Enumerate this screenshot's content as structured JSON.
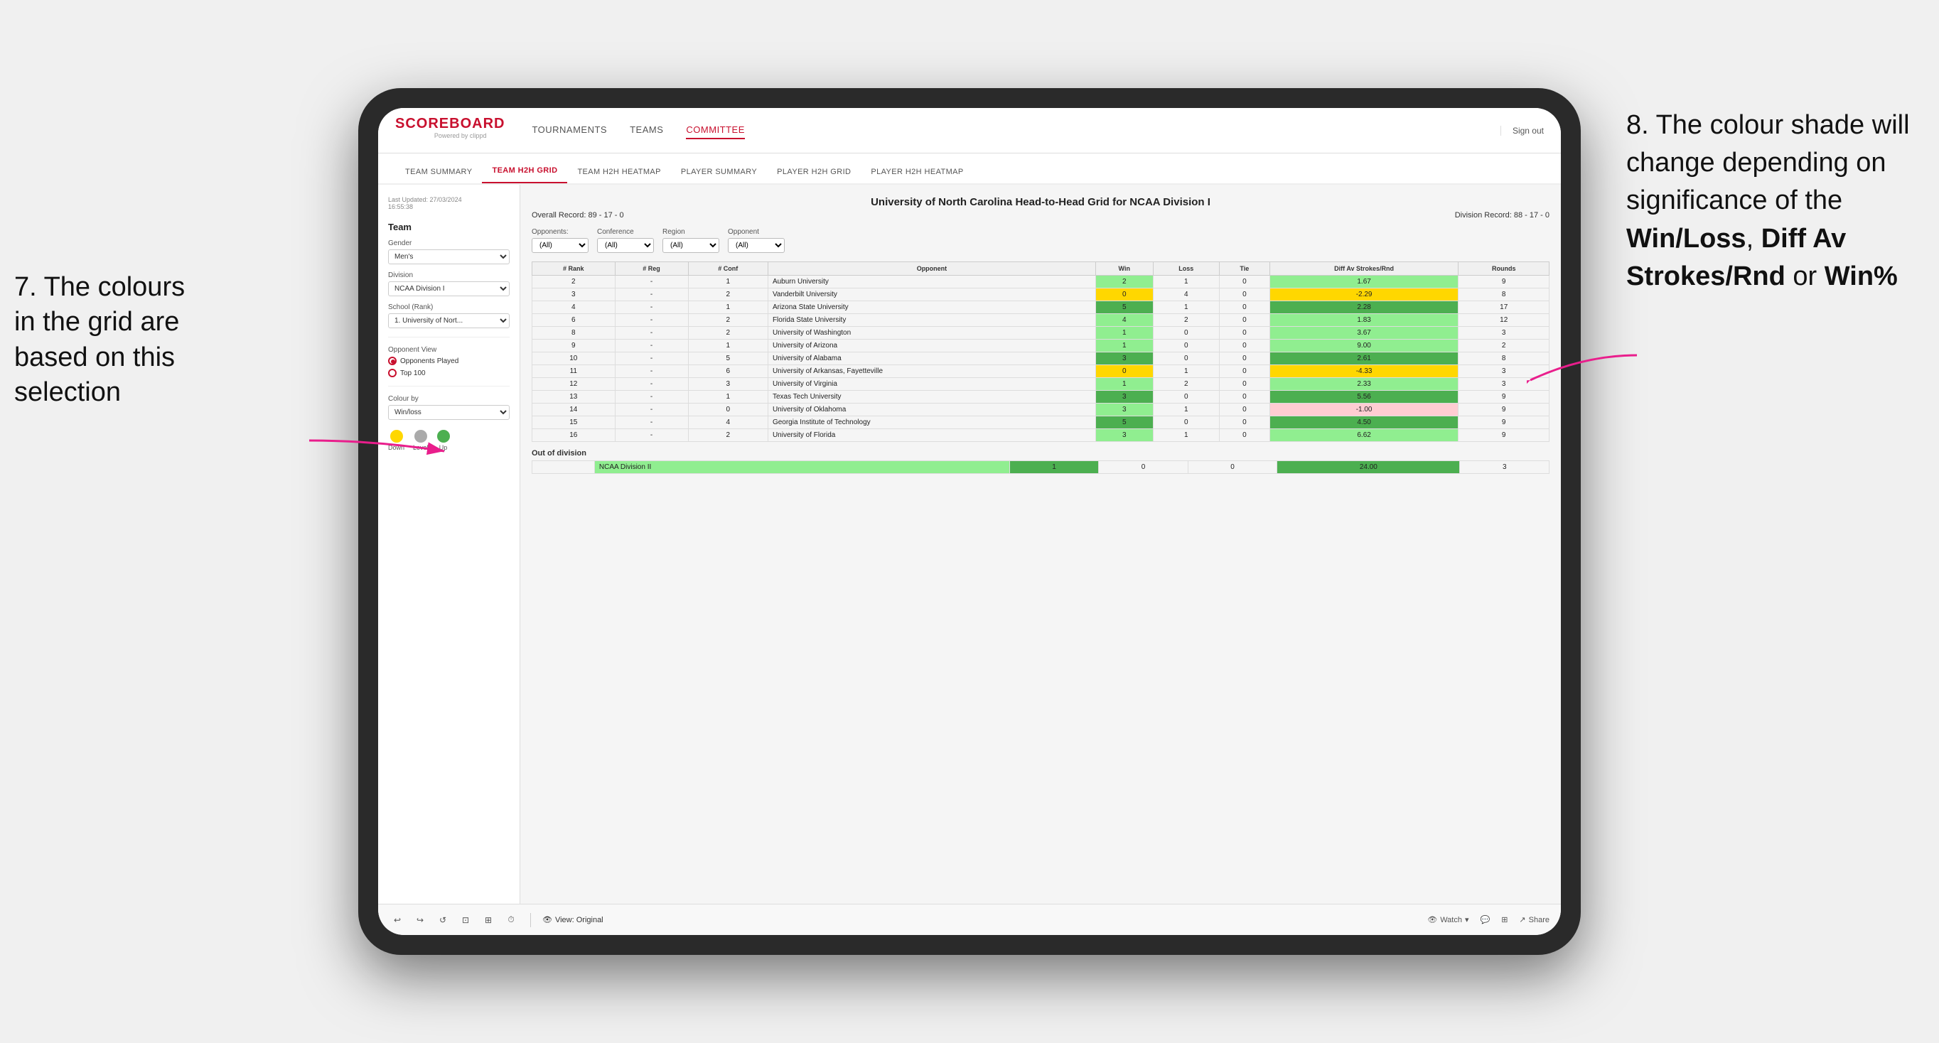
{
  "annotations": {
    "left": {
      "number": "7.",
      "text": "The colours in the grid are based on this selection"
    },
    "right": {
      "number": "8.",
      "text": "The colour shade will change depending on significance of the",
      "bold1": "Win/Loss",
      "bold2": "Diff Av Strokes/Rnd",
      "or": "or",
      "bold3": "Win%"
    }
  },
  "app": {
    "logo": "SCOREBOARD",
    "logo_sub": "Powered by clippd",
    "sign_out": "Sign out",
    "nav": [
      "TOURNAMENTS",
      "TEAMS",
      "COMMITTEE"
    ],
    "active_nav": "COMMITTEE",
    "subnav": [
      "TEAM SUMMARY",
      "TEAM H2H GRID",
      "TEAM H2H HEATMAP",
      "PLAYER SUMMARY",
      "PLAYER H2H GRID",
      "PLAYER H2H HEATMAP"
    ],
    "active_subnav": "TEAM H2H GRID"
  },
  "sidebar": {
    "timestamp": "Last Updated: 27/03/2024\n16:55:38",
    "section_label": "Team",
    "gender_label": "Gender",
    "gender_value": "Men's",
    "division_label": "Division",
    "division_value": "NCAA Division I",
    "school_label": "School (Rank)",
    "school_value": "1. University of Nort...",
    "opponent_view_label": "Opponent View",
    "radio_options": [
      "Opponents Played",
      "Top 100"
    ],
    "active_radio": "Opponents Played",
    "colour_by_label": "Colour by",
    "colour_by_value": "Win/loss",
    "legend": [
      {
        "label": "Down",
        "color": "#ffd700"
      },
      {
        "label": "Level",
        "color": "#aaa"
      },
      {
        "label": "Up",
        "color": "#4caf50"
      }
    ]
  },
  "grid": {
    "title": "University of North Carolina Head-to-Head Grid for NCAA Division I",
    "overall_record": "Overall Record: 89 - 17 - 0",
    "division_record": "Division Record: 88 - 17 - 0",
    "filters": {
      "opponents_label": "Opponents:",
      "opponents_value": "(All)",
      "conference_label": "Conference",
      "conference_value": "(All)",
      "region_label": "Region",
      "region_value": "(All)",
      "opponent_label": "Opponent",
      "opponent_value": "(All)"
    },
    "columns": [
      "#\nRank",
      "#\nReg",
      "#\nConf",
      "Opponent",
      "Win",
      "Loss",
      "Tie",
      "Diff Av\nStrokes/Rnd",
      "Rounds"
    ],
    "rows": [
      {
        "rank": "2",
        "reg": "-",
        "conf": "1",
        "opponent": "Auburn University",
        "win": "2",
        "loss": "1",
        "tie": "0",
        "diff": "1.67",
        "rounds": "9",
        "win_color": "green-light",
        "diff_color": "green-light"
      },
      {
        "rank": "3",
        "reg": "-",
        "conf": "2",
        "opponent": "Vanderbilt University",
        "win": "0",
        "loss": "4",
        "tie": "0",
        "diff": "-2.29",
        "rounds": "8",
        "win_color": "yellow",
        "diff_color": "yellow"
      },
      {
        "rank": "4",
        "reg": "-",
        "conf": "1",
        "opponent": "Arizona State University",
        "win": "5",
        "loss": "1",
        "tie": "0",
        "diff": "2.28",
        "rounds": "17",
        "win_color": "green-mid",
        "diff_color": "green-mid"
      },
      {
        "rank": "6",
        "reg": "-",
        "conf": "2",
        "opponent": "Florida State University",
        "win": "4",
        "loss": "2",
        "tie": "0",
        "diff": "1.83",
        "rounds": "12",
        "win_color": "green-light",
        "diff_color": "green-light"
      },
      {
        "rank": "8",
        "reg": "-",
        "conf": "2",
        "opponent": "University of Washington",
        "win": "1",
        "loss": "0",
        "tie": "0",
        "diff": "3.67",
        "rounds": "3",
        "win_color": "green-light",
        "diff_color": "green-light"
      },
      {
        "rank": "9",
        "reg": "-",
        "conf": "1",
        "opponent": "University of Arizona",
        "win": "1",
        "loss": "0",
        "tie": "0",
        "diff": "9.00",
        "rounds": "2",
        "win_color": "green-light",
        "diff_color": "green-light"
      },
      {
        "rank": "10",
        "reg": "-",
        "conf": "5",
        "opponent": "University of Alabama",
        "win": "3",
        "loss": "0",
        "tie": "0",
        "diff": "2.61",
        "rounds": "8",
        "win_color": "green-mid",
        "diff_color": "green-mid"
      },
      {
        "rank": "11",
        "reg": "-",
        "conf": "6",
        "opponent": "University of Arkansas, Fayetteville",
        "win": "0",
        "loss": "1",
        "tie": "0",
        "diff": "-4.33",
        "rounds": "3",
        "win_color": "yellow",
        "diff_color": "yellow"
      },
      {
        "rank": "12",
        "reg": "-",
        "conf": "3",
        "opponent": "University of Virginia",
        "win": "1",
        "loss": "2",
        "tie": "0",
        "diff": "2.33",
        "rounds": "3",
        "win_color": "green-light",
        "diff_color": "green-light"
      },
      {
        "rank": "13",
        "reg": "-",
        "conf": "1",
        "opponent": "Texas Tech University",
        "win": "3",
        "loss": "0",
        "tie": "0",
        "diff": "5.56",
        "rounds": "9",
        "win_color": "green-mid",
        "diff_color": "green-mid"
      },
      {
        "rank": "14",
        "reg": "-",
        "conf": "0",
        "opponent": "University of Oklahoma",
        "win": "3",
        "loss": "1",
        "tie": "0",
        "diff": "-1.00",
        "rounds": "9",
        "win_color": "green-light",
        "diff_color": "red-light"
      },
      {
        "rank": "15",
        "reg": "-",
        "conf": "4",
        "opponent": "Georgia Institute of Technology",
        "win": "5",
        "loss": "0",
        "tie": "0",
        "diff": "4.50",
        "rounds": "9",
        "win_color": "green-mid",
        "diff_color": "green-mid"
      },
      {
        "rank": "16",
        "reg": "-",
        "conf": "2",
        "opponent": "University of Florida",
        "win": "3",
        "loss": "1",
        "tie": "0",
        "diff": "6.62",
        "rounds": "9",
        "win_color": "green-light",
        "diff_color": "green-light"
      }
    ],
    "out_of_division": {
      "label": "Out of division",
      "rows": [
        {
          "opponent": "NCAA Division II",
          "win": "1",
          "loss": "0",
          "tie": "0",
          "diff": "24.00",
          "rounds": "3",
          "win_color": "green-mid",
          "diff_color": "green-mid"
        }
      ]
    }
  },
  "toolbar": {
    "view_label": "View: Original",
    "watch_label": "Watch",
    "share_label": "Share"
  }
}
